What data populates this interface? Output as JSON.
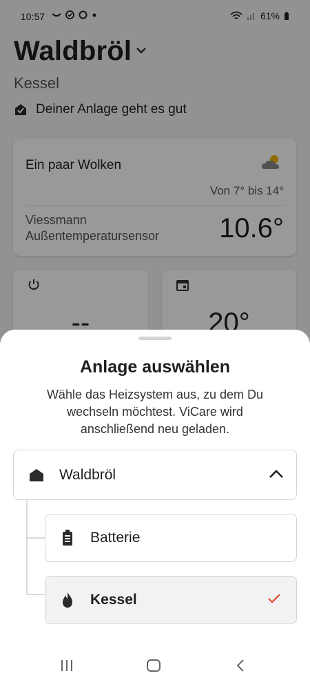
{
  "status_bar": {
    "time": "10:57",
    "battery": "61%"
  },
  "background": {
    "title": "Waldbröl",
    "subtitle": "Kessel",
    "status_text": "Deiner Anlage geht es gut",
    "weather": {
      "condition": "Ein paar Wolken",
      "range": "Von 7° bis 14°",
      "sensor_label": "Viessmann Außentemperatursensor",
      "temperature": "10.6°"
    },
    "tiles": [
      {
        "value": "--"
      },
      {
        "value": "20°"
      }
    ]
  },
  "sheet": {
    "title": "Anlage auswählen",
    "description": "Wähle das Heizsystem aus, zu dem Du wechseln möchtest. ViCare wird anschließend neu geladen.",
    "group": {
      "label": "Waldbröl",
      "expanded": true
    },
    "options": [
      {
        "label": "Batterie",
        "icon": "battery-icon",
        "selected": false
      },
      {
        "label": "Kessel",
        "icon": "flame-icon",
        "selected": true
      }
    ],
    "accent": "#e0462a"
  }
}
